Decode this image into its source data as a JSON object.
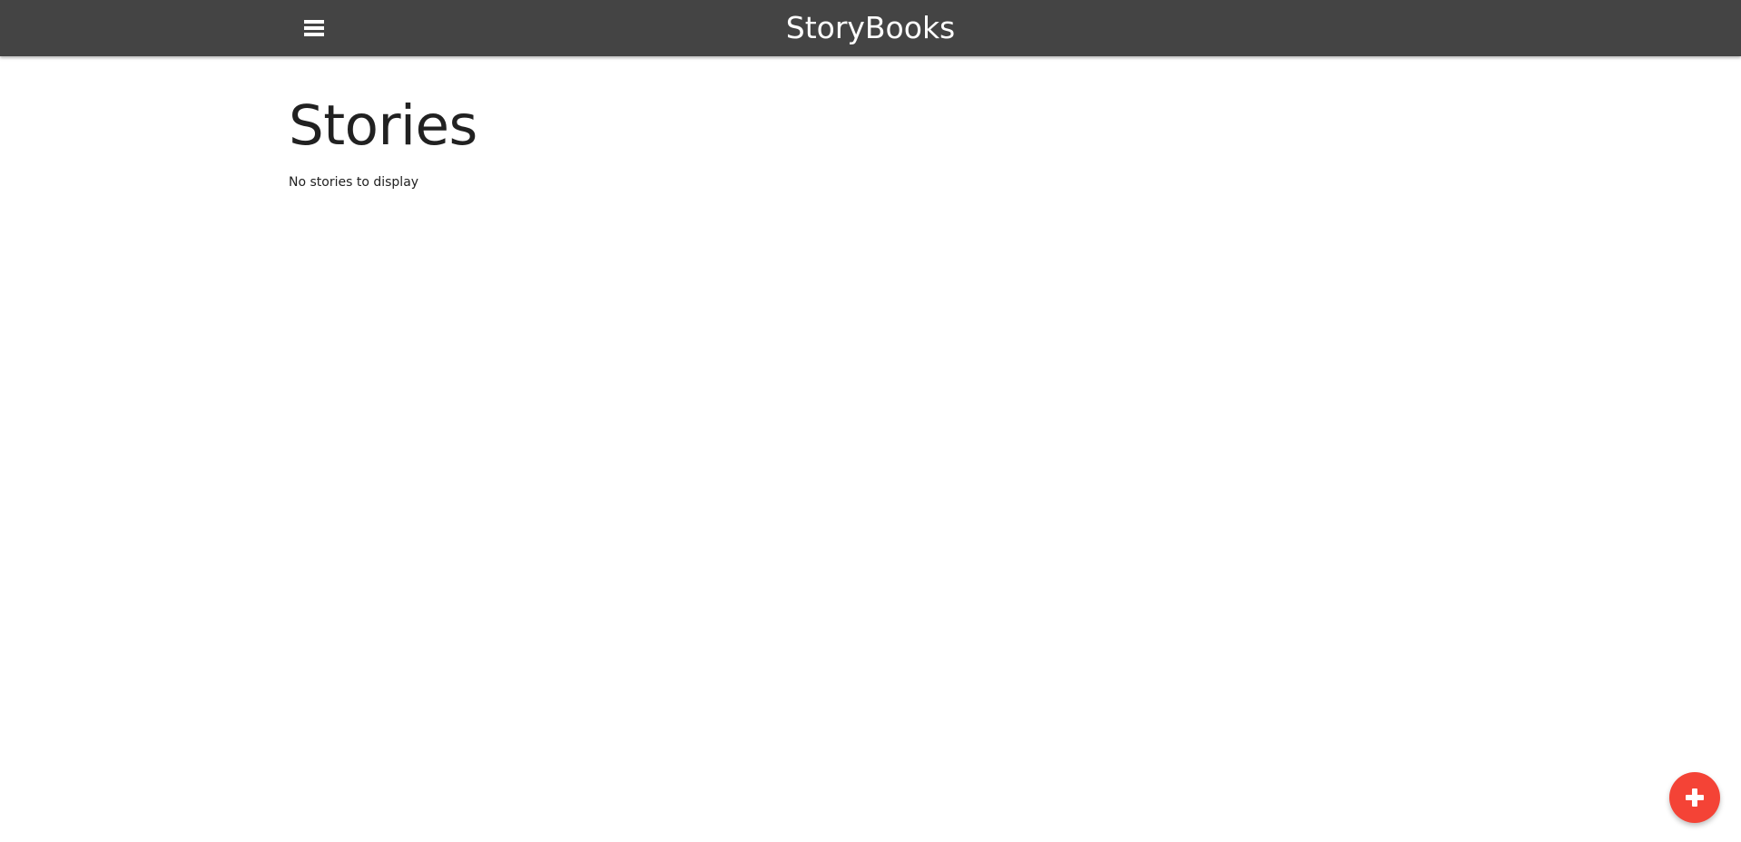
{
  "navbar": {
    "menu_icon": "hamburger-menu-icon",
    "brand": "StoryBooks",
    "background_color": "#444444"
  },
  "main": {
    "title": "Stories",
    "empty_message": "No stories to display"
  },
  "fab": {
    "icon": "plus-icon",
    "color": "#f44336"
  }
}
